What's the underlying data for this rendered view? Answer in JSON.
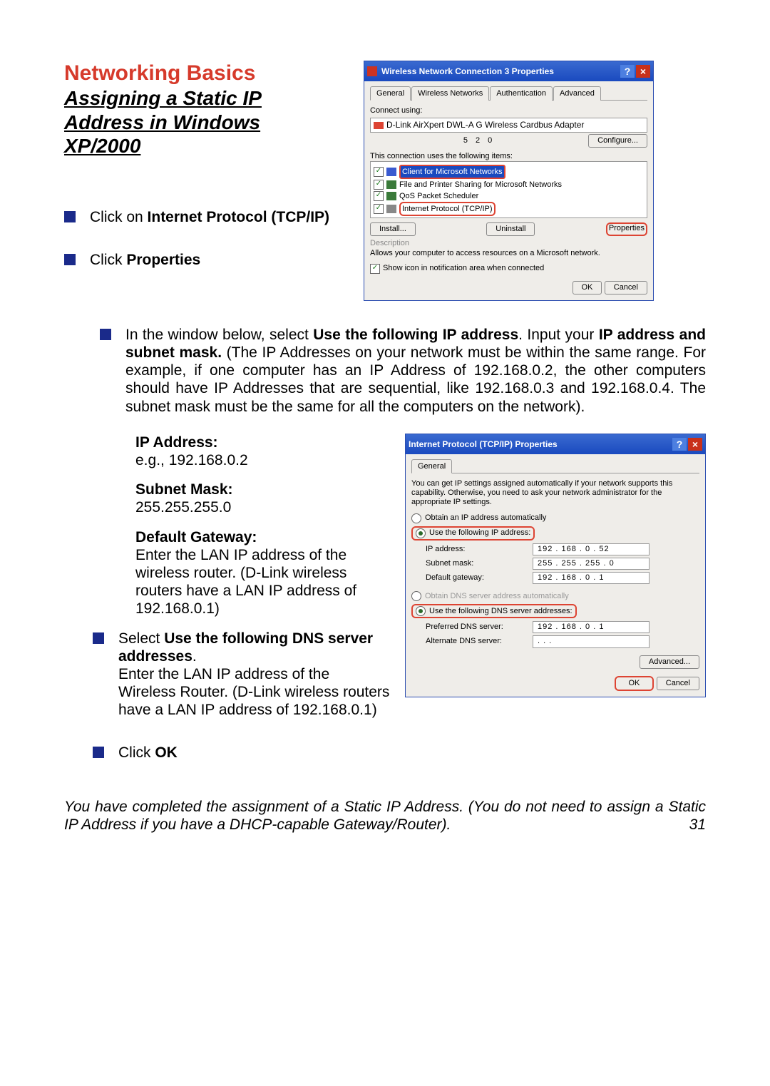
{
  "heading": {
    "title": "Networking Basics",
    "subtitle": "Assigning a Static IP Address in Windows XP/2000"
  },
  "bullets_top": [
    {
      "pre": "Click on ",
      "bold": "Internet Protocol (TCP/IP)"
    },
    {
      "pre": "Click ",
      "bold": "Properties"
    }
  ],
  "middle": {
    "pre": "In the window below, select ",
    "b1": "Use the following IP address",
    "mid": ". Input your ",
    "b2": "IP address and subnet mask.",
    "rest": " (The IP Addresses on your network must be within the same range. For example, if one computer has an IP Address of 192.168.0.2, the other computers should have IP Addresses that are sequential, like 192.168.0.3 and 192.168.0.4.  The subnet mask must be the same for all the computers on the network)."
  },
  "ip_section": {
    "ipaddr_label": "IP Address:",
    "ipaddr_val": "e.g., 192.168.0.2",
    "subnet_label": "Subnet Mask:",
    "subnet_val": "255.255.255.0",
    "gateway_label": "Default Gateway:",
    "gateway_val": "Enter the LAN IP address of the wireless router. (D-Link wireless routers have a LAN IP address of 192.168.0.1)"
  },
  "dns_bullet": {
    "pre": "Select ",
    "bold": "Use the following DNS server addresses",
    "post": ".\nEnter the LAN IP address of the Wireless Router. (D-Link wireless routers have a LAN IP address of 192.168.0.1)"
  },
  "ok_bullet": {
    "pre": "Click ",
    "bold": "OK"
  },
  "footer": "You have completed the assignment of a Static IP Address.  (You do not need to assign a Static IP Address if you have a DHCP-capable Gateway/Router).",
  "page_number": "31",
  "dialog1": {
    "title": "Wireless Network Connection 3 Properties",
    "tabs": [
      "General",
      "Wireless Networks",
      "Authentication",
      "Advanced"
    ],
    "connect_using": "Connect using:",
    "adapter": "D-Link AirXpert DWL-A   G   Wireless Cardbus Adapter",
    "adapter_sub": "5 2 0",
    "configure": "Configure...",
    "uses_label": "This connection uses the following items:",
    "items": [
      "Client for Microsoft Networks",
      "File and Printer Sharing for Microsoft Networks",
      "QoS Packet Scheduler",
      "Internet Protocol (TCP/IP)"
    ],
    "install": "Install...",
    "uninstall": "Uninstall",
    "properties": "Properties",
    "desc_label": "Description",
    "desc_text": "Allows your computer to access resources on a Microsoft network.",
    "show_icon": "Show icon in notification area when connected",
    "ok": "OK",
    "cancel": "Cancel"
  },
  "dialog2": {
    "title": "Internet Protocol (TCP/IP) Properties",
    "tab": "General",
    "intro": "You can get IP settings assigned automatically if your network supports this capability. Otherwise, you need to ask your network administrator for the appropriate IP settings.",
    "radio_auto": "Obtain an IP address automatically",
    "radio_use": "Use the following IP address:",
    "ip_label": "IP address:",
    "ip_val": "192 . 168 .   0  .  52",
    "subnet_label": "Subnet mask:",
    "subnet_val": "255 . 255 . 255 .   0",
    "gateway_label": "Default gateway:",
    "gateway_val": "192 . 168 .   0  .   1",
    "dns_auto": "Obtain DNS server address automatically",
    "dns_use": "Use the following DNS server addresses:",
    "pref_label": "Preferred DNS server:",
    "pref_val": "192 . 168 .   0  .   1",
    "alt_label": "Alternate DNS server:",
    "alt_val": ".       .       .",
    "advanced": "Advanced...",
    "ok": "OK",
    "cancel": "Cancel"
  }
}
